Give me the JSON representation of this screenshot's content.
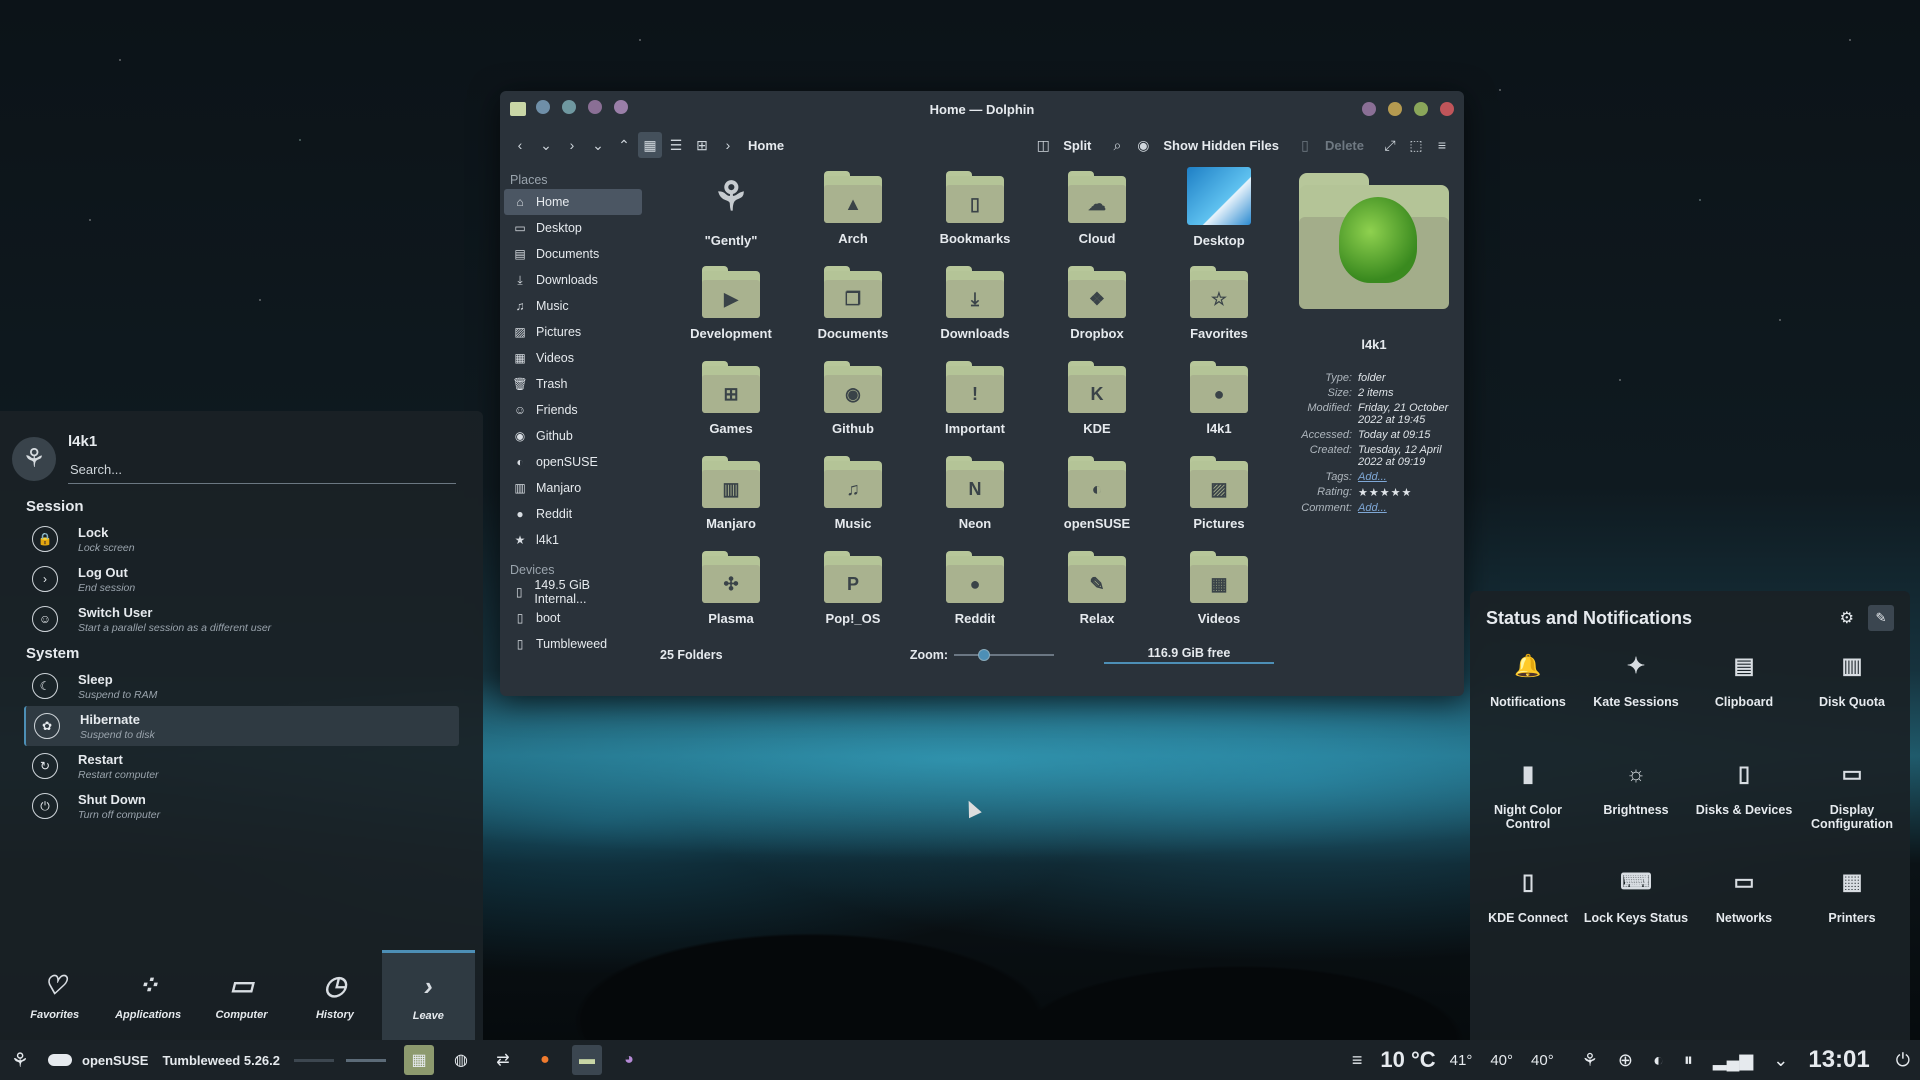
{
  "window": {
    "title": "Home — Dolphin",
    "button_colors": [
      "#6f8fa8",
      "#6f98a0",
      "#8a6f95",
      "#9a7fa8"
    ],
    "control_colors": [
      "#8a6f95",
      "#b59a50",
      "#8aa65a",
      "#c0555a"
    ]
  },
  "toolbar": {
    "breadcrumb": "Home",
    "split": "Split",
    "show_hidden": "Show Hidden Files",
    "delete": "Delete"
  },
  "places": {
    "header": "Places",
    "items": [
      {
        "label": "Home",
        "icon": "⌂"
      },
      {
        "label": "Desktop",
        "icon": "▭"
      },
      {
        "label": "Documents",
        "icon": "▤"
      },
      {
        "label": "Downloads",
        "icon": "⤓"
      },
      {
        "label": "Music",
        "icon": "♫"
      },
      {
        "label": "Pictures",
        "icon": "▨"
      },
      {
        "label": "Videos",
        "icon": "▦"
      },
      {
        "label": "Trash",
        "icon": "🗑"
      },
      {
        "label": "Friends",
        "icon": "☺"
      },
      {
        "label": "Github",
        "icon": "◉"
      },
      {
        "label": "openSUSE",
        "icon": "◐"
      },
      {
        "label": "Manjaro",
        "icon": "▥"
      },
      {
        "label": "Reddit",
        "icon": "●"
      },
      {
        "label": "l4k1",
        "icon": "★"
      }
    ],
    "devices_header": "Devices",
    "devices": [
      {
        "label": "149.5 GiB Internal..."
      },
      {
        "label": "boot"
      },
      {
        "label": "Tumbleweed"
      }
    ]
  },
  "files": [
    {
      "name": "\"Gently\"",
      "glyph": "⚘"
    },
    {
      "name": "Arch",
      "glyph": "▲"
    },
    {
      "name": "Bookmarks",
      "glyph": "▯"
    },
    {
      "name": "Cloud",
      "glyph": "☁"
    },
    {
      "name": "Desktop",
      "glyph": ""
    },
    {
      "name": "Development",
      "glyph": "▶"
    },
    {
      "name": "Documents",
      "glyph": "❐"
    },
    {
      "name": "Downloads",
      "glyph": "⤓"
    },
    {
      "name": "Dropbox",
      "glyph": "❖"
    },
    {
      "name": "Favorites",
      "glyph": "☆"
    },
    {
      "name": "Games",
      "glyph": "⊞"
    },
    {
      "name": "Github",
      "glyph": "◉"
    },
    {
      "name": "Important",
      "glyph": "!"
    },
    {
      "name": "KDE",
      "glyph": "K"
    },
    {
      "name": "l4k1",
      "glyph": "●"
    },
    {
      "name": "Manjaro",
      "glyph": "▥"
    },
    {
      "name": "Music",
      "glyph": "♫"
    },
    {
      "name": "Neon",
      "glyph": "N"
    },
    {
      "name": "openSUSE",
      "glyph": "◐"
    },
    {
      "name": "Pictures",
      "glyph": "▨"
    },
    {
      "name": "Plasma",
      "glyph": "✣"
    },
    {
      "name": "Pop!_OS",
      "glyph": "P"
    },
    {
      "name": "Reddit",
      "glyph": "●"
    },
    {
      "name": "Relax",
      "glyph": "✎"
    },
    {
      "name": "Videos",
      "glyph": "▦"
    }
  ],
  "info": {
    "name": "l4k1",
    "rows": [
      {
        "k": "Type:",
        "v": "folder"
      },
      {
        "k": "Size:",
        "v": "2 items"
      },
      {
        "k": "Modified:",
        "v": "Friday, 21 October 2022 at 19:45"
      },
      {
        "k": "Accessed:",
        "v": "Today at 09:15"
      },
      {
        "k": "Created:",
        "v": "Tuesday, 12 April 2022 at 09:19"
      }
    ],
    "tags_label": "Tags:",
    "tags_link": "Add...",
    "rating_label": "Rating:",
    "rating_value": "5",
    "rating_stars": "★★★★★",
    "comment_label": "Comment:",
    "comment_link": "Add..."
  },
  "statusbar": {
    "count": "25 Folders",
    "zoom_label": "Zoom:",
    "free": "116.9 GiB free"
  },
  "launcher": {
    "user": "l4k1",
    "search_placeholder": "Search...",
    "session_header": "Session",
    "session": [
      {
        "title": "Lock",
        "sub": "Lock screen",
        "icon": "🔒"
      },
      {
        "title": "Log Out",
        "sub": "End session",
        "icon": "›"
      },
      {
        "title": "Switch User",
        "sub": "Start a parallel session as a different user",
        "icon": "☺"
      }
    ],
    "system_header": "System",
    "system": [
      {
        "title": "Sleep",
        "sub": "Suspend to RAM",
        "icon": "☾"
      },
      {
        "title": "Hibernate",
        "sub": "Suspend to disk",
        "icon": "✿"
      },
      {
        "title": "Restart",
        "sub": "Restart computer",
        "icon": "↻"
      },
      {
        "title": "Shut Down",
        "sub": "Turn off computer",
        "icon": "⏻"
      }
    ],
    "tabs": [
      {
        "label": "Favorites",
        "icon": "♡"
      },
      {
        "label": "Applications",
        "icon": "⁘"
      },
      {
        "label": "Computer",
        "icon": "▭"
      },
      {
        "label": "History",
        "icon": "◷"
      },
      {
        "label": "Leave",
        "icon": "›"
      }
    ]
  },
  "status_panel": {
    "title": "Status and Notifications",
    "items": [
      {
        "label": "Notifications",
        "icon": "🔔"
      },
      {
        "label": "Kate Sessions",
        "icon": "✦"
      },
      {
        "label": "Clipboard",
        "icon": "▤"
      },
      {
        "label": "Disk Quota",
        "icon": "▥"
      },
      {
        "label": "Night Color Control",
        "icon": "▮"
      },
      {
        "label": "Brightness",
        "icon": "☼"
      },
      {
        "label": "Disks & Devices",
        "icon": "▯"
      },
      {
        "label": "Display Configuration",
        "icon": "▭"
      },
      {
        "label": "KDE Connect",
        "icon": "▯"
      },
      {
        "label": "Lock Keys Status",
        "icon": "⌨"
      },
      {
        "label": "Networks",
        "icon": "▭"
      },
      {
        "label": "Printers",
        "icon": "▦"
      }
    ]
  },
  "panel": {
    "distro": "openSUSE",
    "version": "Tumbleweed 5.26.2",
    "temp": "10 °C",
    "temps": [
      "41°",
      "40°",
      "40°"
    ],
    "clock": "13:01"
  }
}
